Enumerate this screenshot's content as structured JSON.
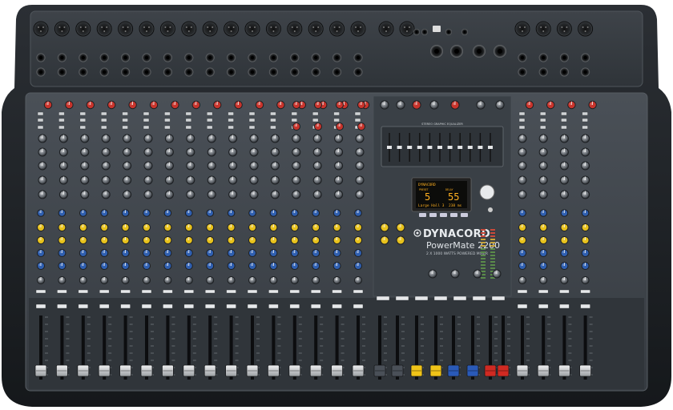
{
  "device": {
    "brand": "DYNACORD",
    "model": "PowerMate 2200",
    "tagline": "2 X 1000 WATTS POWERED MIXER",
    "mono_channels": 16,
    "stereo_channels": 4,
    "mic_inputs_total": 22
  },
  "graphic_eq": {
    "label": "STEREO GRAPHIC EQUALIZER",
    "band_count": 11
  },
  "fx_display": {
    "header": "DYNACORD",
    "left_preset_number": "5",
    "right_preset_number": "55",
    "left_preset_name": "Large Hall 3",
    "right_value": "238 ms",
    "left_label": "PRESET",
    "right_label": "DELAY"
  },
  "colors": {
    "panel": "#3c4248",
    "panel_dark": "#2a2f34",
    "chassis": "#1e2125",
    "knob_red": "#c8342c",
    "knob_yellow": "#e8c21c",
    "knob_blue": "#2f5fb0",
    "fader_cap": "#d8dadc",
    "cap_blue": "#2a5ab8",
    "cap_yellow": "#f0c418",
    "cap_red": "#d02a22",
    "cap_dark": "#4a5058"
  }
}
